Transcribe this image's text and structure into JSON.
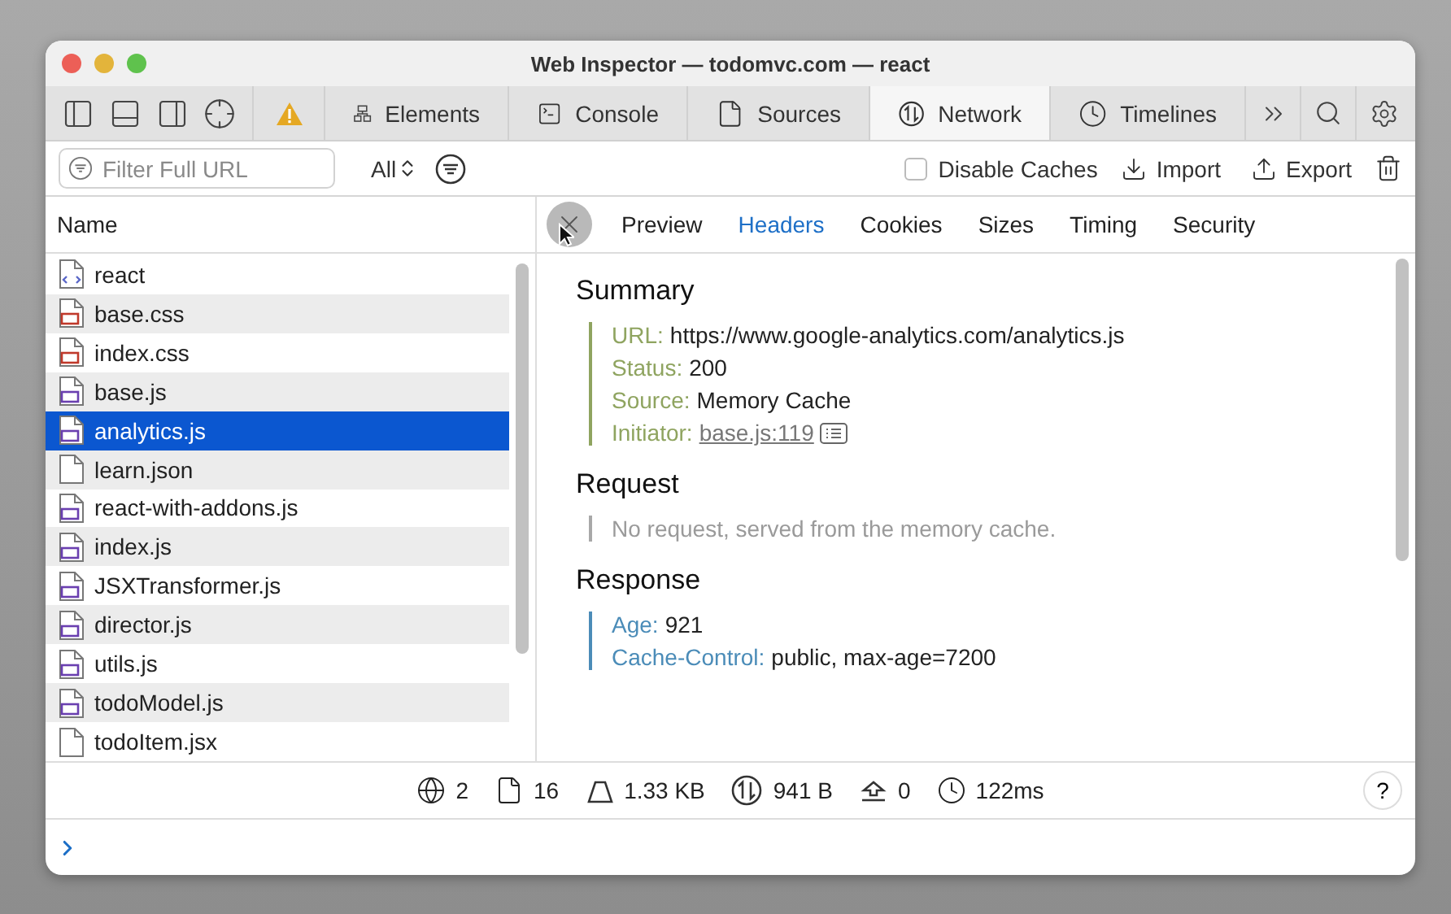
{
  "window": {
    "title": "Web Inspector — todomvc.com — react"
  },
  "tabs": [
    {
      "label": "Elements",
      "selected": false
    },
    {
      "label": "Console",
      "selected": false
    },
    {
      "label": "Sources",
      "selected": false
    },
    {
      "label": "Network",
      "selected": true
    },
    {
      "label": "Timelines",
      "selected": false
    }
  ],
  "filter_bar": {
    "placeholder": "Filter Full URL",
    "type_filter": "All",
    "disable_caches": {
      "label": "Disable Caches",
      "checked": false
    },
    "import": "Import",
    "export": "Export"
  },
  "table": {
    "column": "Name",
    "rows": [
      {
        "name": "react",
        "kind": "document",
        "selected": false
      },
      {
        "name": "base.css",
        "kind": "stylesheet",
        "selected": false
      },
      {
        "name": "index.css",
        "kind": "stylesheet",
        "selected": false
      },
      {
        "name": "base.js",
        "kind": "script",
        "selected": false
      },
      {
        "name": "analytics.js",
        "kind": "script",
        "selected": true
      },
      {
        "name": "learn.json",
        "kind": "plain",
        "selected": false
      },
      {
        "name": "react-with-addons.js",
        "kind": "script",
        "selected": false
      },
      {
        "name": "index.js",
        "kind": "script",
        "selected": false
      },
      {
        "name": "JSXTransformer.js",
        "kind": "script",
        "selected": false
      },
      {
        "name": "director.js",
        "kind": "script",
        "selected": false
      },
      {
        "name": "utils.js",
        "kind": "script",
        "selected": false
      },
      {
        "name": "todoModel.js",
        "kind": "script",
        "selected": false
      },
      {
        "name": "todoItem.jsx",
        "kind": "plain",
        "selected": false
      }
    ]
  },
  "detail_tabs": [
    {
      "label": "Preview",
      "selected": false
    },
    {
      "label": "Headers",
      "selected": true
    },
    {
      "label": "Cookies",
      "selected": false
    },
    {
      "label": "Sizes",
      "selected": false
    },
    {
      "label": "Timing",
      "selected": false
    },
    {
      "label": "Security",
      "selected": false
    }
  ],
  "sections": [
    {
      "title": "Summary",
      "kind": "fields",
      "color": "#8fa460",
      "fields": [
        {
          "key": "URL:",
          "value": "https://www.google-analytics.com/analytics.js",
          "kind": "text"
        },
        {
          "key": "Status:",
          "value": "200",
          "kind": "text"
        },
        {
          "key": "Source:",
          "value": "Memory Cache",
          "kind": "text"
        },
        {
          "key": "Initiator:",
          "value": "base.js:119",
          "kind": "link"
        }
      ]
    },
    {
      "title": "Request",
      "kind": "note",
      "color": "#a8a8a8",
      "text": "No request, served from the memory cache."
    },
    {
      "title": "Response",
      "kind": "fields",
      "color": "#4b8cb8",
      "fields": [
        {
          "key": "Age:",
          "value": "921",
          "kind": "text"
        },
        {
          "key": "Cache-Control:",
          "value": "public, max-age=7200",
          "kind": "text"
        }
      ]
    }
  ],
  "status_bar": [
    {
      "kind": "domains",
      "text": "2"
    },
    {
      "kind": "resources",
      "text": "16"
    },
    {
      "kind": "size",
      "text": "1.33 KB"
    },
    {
      "kind": "transferred",
      "text": "941 B"
    },
    {
      "kind": "redirects",
      "text": "0"
    },
    {
      "kind": "time",
      "text": "122ms"
    }
  ],
  "help": "?"
}
